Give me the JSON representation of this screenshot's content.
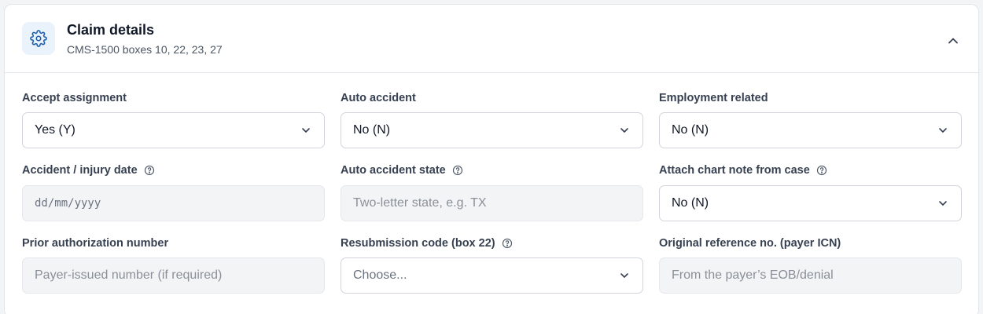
{
  "header": {
    "icon": "gear-icon",
    "title": "Claim details",
    "subtitle": "CMS-1500 boxes 10, 22, 23, 27",
    "collapse_icon": "chevron-up-icon"
  },
  "fields": {
    "accept_assignment": {
      "label": "Accept assignment",
      "value": "Yes (Y)"
    },
    "auto_accident": {
      "label": "Auto accident",
      "value": "No (N)"
    },
    "employment_related": {
      "label": "Employment related",
      "value": "No (N)"
    },
    "accident_date": {
      "label": "Accident / injury date",
      "placeholder": "dd/mm/yyyy",
      "value": ""
    },
    "auto_accident_state": {
      "label": "Auto accident state",
      "placeholder": "Two-letter state, e.g. TX",
      "value": ""
    },
    "attach_chart_note": {
      "label": "Attach chart note from case",
      "value": "No (N)"
    },
    "prior_authorization": {
      "label": "Prior authorization number",
      "placeholder": "Payer-issued number (if required)",
      "value": ""
    },
    "resubmission_code": {
      "label": "Resubmission code (box 22)",
      "value": "Choose..."
    },
    "original_reference": {
      "label": "Original reference no. (payer ICN)",
      "placeholder": "From the payer’s EOB/denial",
      "value": ""
    }
  },
  "colors": {
    "accent": "#1d5fa8",
    "icon_bg": "#eaf2fb",
    "input_bg": "#f3f4f6",
    "border": "#d1d5db"
  }
}
